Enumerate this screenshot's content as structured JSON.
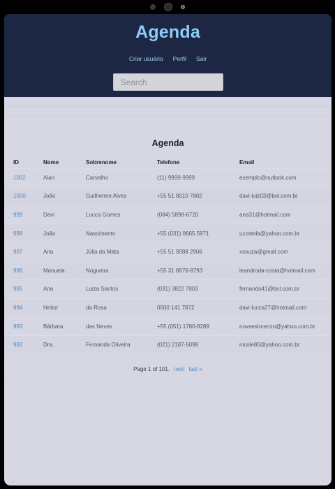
{
  "header": {
    "title": "Agenda",
    "nav": [
      "Criar usuário",
      "Perfil",
      "Sair"
    ],
    "search_placeholder": "Search"
  },
  "table": {
    "title": "Agenda",
    "columns": [
      "ID",
      "Nome",
      "Sobrenome",
      "Telefone",
      "Email"
    ],
    "rows": [
      {
        "id": "1002",
        "nome": "Alan",
        "sobrenome": "Carvalho",
        "telefone": "(11) 9999-9999",
        "email": "exemplo@outlook.com"
      },
      {
        "id": "1000",
        "nome": "João",
        "sobrenome": "Guilherme Alves",
        "telefone": "+55 51 8010 7802",
        "email": "davi-luiz03@bol.com.br"
      },
      {
        "id": "999",
        "nome": "Davi",
        "sobrenome": "Lucca Gomes",
        "telefone": "(084) 5898-6720",
        "email": "ana31@hotmail.com"
      },
      {
        "id": "998",
        "nome": "João",
        "sobrenome": "Nascimento",
        "telefone": "+55 (031) 8665 5971",
        "email": "ucostela@yahoo.com.br"
      },
      {
        "id": "997",
        "nome": "Ana",
        "sobrenome": "Júlia da Mata",
        "telefone": "+55 51 9088 2906",
        "email": "xsouza@gmail.com"
      },
      {
        "id": "996",
        "nome": "Manuela",
        "sobrenome": "Nogueira",
        "telefone": "+55 31 8876-8793",
        "email": "leandroda-costa@hotmail.com"
      },
      {
        "id": "995",
        "nome": "Ana",
        "sobrenome": "Luiza Santos",
        "telefone": "(031) 3822 7803",
        "email": "fernando41@bol.com.br"
      },
      {
        "id": "994",
        "nome": "Heitor",
        "sobrenome": "da Rosa",
        "telefone": "0500 141 7872",
        "email": "davi-lucca27@hotmail.com"
      },
      {
        "id": "993",
        "nome": "Bárbara",
        "sobrenome": "das Neves",
        "telefone": "+55 (051) 1780-8289",
        "email": "novaeslorenzo@yahoo.com.br"
      },
      {
        "id": "992",
        "nome": "Dra.",
        "sobrenome": "Fernanda Oliveira",
        "telefone": "(021) 2187-5098",
        "email": "nicole80@yahoo.com.br"
      }
    ]
  },
  "pagination": {
    "text": "Page 1 of 101.",
    "next": "next",
    "last": "last »"
  }
}
